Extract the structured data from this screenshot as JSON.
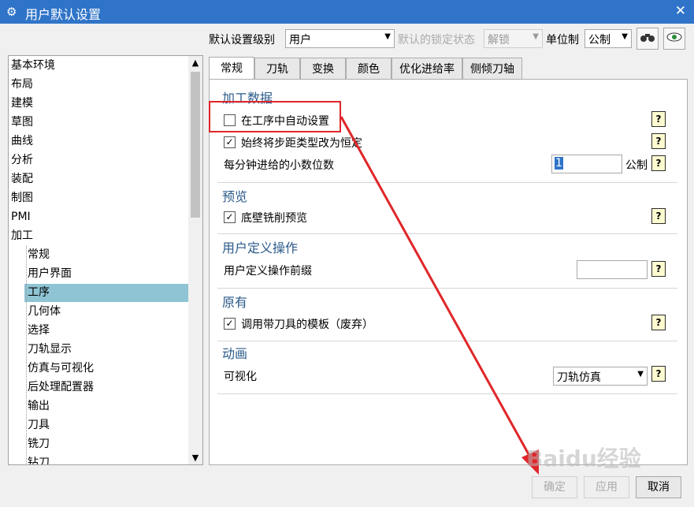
{
  "window": {
    "title": "用户默认设置",
    "close": "✕"
  },
  "toolbar": {
    "level_label": "默认设置级别",
    "level_value": "用户",
    "lock_label": "默认的锁定状态",
    "lock_value": "解锁",
    "unit_label": "单位制",
    "unit_value": "公制"
  },
  "tree": {
    "top_items": [
      "基本环境",
      "布局",
      "建模",
      "草图",
      "曲线",
      "分析",
      "装配",
      "制图",
      "PMI",
      "加工"
    ],
    "sub_items": [
      "常规",
      "用户界面",
      "工序",
      "几何体",
      "选择",
      "刀轨显示",
      "仿真与可视化",
      "后处理配置器",
      "输出",
      "刀具",
      "铣刀",
      "钻刀"
    ],
    "selected": "工序"
  },
  "tabs": [
    "常规",
    "刀轨",
    "变换",
    "颜色",
    "优化进给率",
    "侧倾刀轴"
  ],
  "sections": {
    "machining": {
      "title": "加工数据",
      "auto_set": "在工序中自动设置",
      "auto_set_checked": false,
      "always_change": "始终将步距类型改为恒定",
      "always_change_checked": true,
      "decimals_label": "每分钟进给的小数位数",
      "decimals_value": "1",
      "decimals_unit": "公制"
    },
    "preview": {
      "title": "预览",
      "floor_preview": "底壁铣削预览",
      "floor_preview_checked": true
    },
    "user_defined": {
      "title": "用户定义操作",
      "prefix_label": "用户定义操作前缀",
      "prefix_value": ""
    },
    "legacy": {
      "title": "原有",
      "template_label": "调用带刀具的模板（废弃）",
      "template_checked": true
    },
    "animation": {
      "title": "动画",
      "visualize_label": "可视化",
      "visualize_value": "刀轨仿真"
    }
  },
  "buttons": {
    "ok": "确定",
    "apply": "应用",
    "cancel": "取消"
  },
  "watermark": "Baidu经验",
  "colors": {
    "titlebar": "#2f74c8",
    "selection": "#8fc4d4",
    "annotation": "#e0262a",
    "section_title": "#2a5a8a"
  },
  "icons": [
    "gear-icon",
    "close-icon",
    "binoculars-icon",
    "eye-icon",
    "help-icon",
    "checkmark-icon",
    "chevron-down-icon"
  ]
}
